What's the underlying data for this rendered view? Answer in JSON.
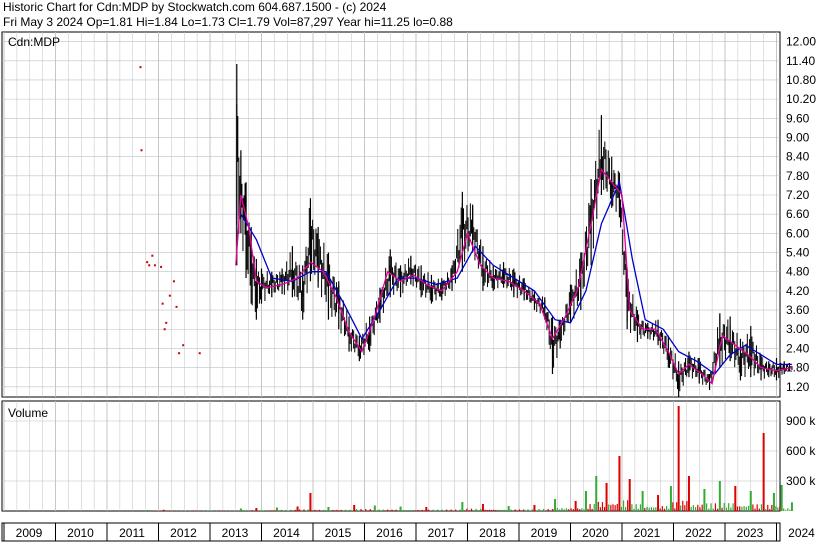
{
  "header": {
    "line1": "Historic Chart for Cdn:MDP by Stockwatch.com 604.687.1500 - (c) 2024",
    "line2": "Fri May  3 2024   Op=1.81  Hi=1.84  Lo=1.73  Cl=1.79  Vol=87,297  Year hi=11.25  lo=0.88"
  },
  "colors": {
    "price_bars": "#000000",
    "ma_short": "#e0009a",
    "ma_long": "#0000cc",
    "early_points": "#cc0000",
    "volume_up": "#33aa33",
    "volume_down": "#dd0000",
    "grid": "#c0c0c0",
    "panel_border": "#000000"
  },
  "chart_data": [
    {
      "type": "line",
      "title": "Cdn:MDP",
      "xlabel": "",
      "ylabel": "",
      "x_tick_labels": [
        "2009",
        "2010",
        "2011",
        "2012",
        "2013",
        "2014",
        "2015",
        "2016",
        "2017",
        "2018",
        "2019",
        "2020",
        "2021",
        "2022",
        "2023",
        "2024"
      ],
      "y_tick_labels": [
        "12.00",
        "11.40",
        "10.80",
        "10.20",
        "9.60",
        "9.00",
        "8.40",
        "7.80",
        "7.20",
        "6.60",
        "6.00",
        "5.40",
        "4.80",
        "4.20",
        "3.60",
        "3.00",
        "2.40",
        "1.80",
        "1.20"
      ],
      "ylim": [
        0.88,
        12.3
      ],
      "grid": true,
      "series": [
        {
          "kind": "points",
          "values": [
            {
              "x": 2011.65,
              "y": 11.2
            },
            {
              "x": 2011.67,
              "y": 8.6
            },
            {
              "x": 2011.78,
              "y": 5.1
            },
            {
              "x": 2011.82,
              "y": 5.0
            },
            {
              "x": 2011.88,
              "y": 5.3
            },
            {
              "x": 2011.93,
              "y": 5.0
            },
            {
              "x": 2012.05,
              "y": 4.95
            },
            {
              "x": 2012.08,
              "y": 3.8
            },
            {
              "x": 2012.12,
              "y": 3.0
            },
            {
              "x": 2012.15,
              "y": 3.2
            },
            {
              "x": 2012.22,
              "y": 4.05
            },
            {
              "x": 2012.3,
              "y": 4.5
            },
            {
              "x": 2012.35,
              "y": 3.7
            },
            {
              "x": 2012.4,
              "y": 2.25
            },
            {
              "x": 2012.48,
              "y": 2.5
            },
            {
              "x": 2012.8,
              "y": 2.25
            }
          ]
        },
        {
          "kind": "price_bars",
          "values": [
            {
              "x": 2013.52,
              "lo": 5.0,
              "hi": 11.3
            },
            {
              "x": 2013.6,
              "lo": 6.0,
              "hi": 8.6
            },
            {
              "x": 2013.7,
              "lo": 4.6,
              "hi": 7.6
            },
            {
              "x": 2013.8,
              "lo": 3.8,
              "hi": 6.2
            },
            {
              "x": 2013.9,
              "lo": 3.3,
              "hi": 5.2
            },
            {
              "x": 2014.0,
              "lo": 3.8,
              "hi": 4.9
            },
            {
              "x": 2014.2,
              "lo": 4.0,
              "hi": 4.8
            },
            {
              "x": 2014.4,
              "lo": 4.1,
              "hi": 4.9
            },
            {
              "x": 2014.6,
              "lo": 4.0,
              "hi": 5.6
            },
            {
              "x": 2014.8,
              "lo": 3.3,
              "hi": 5.0
            },
            {
              "x": 2014.95,
              "lo": 4.5,
              "hi": 7.1
            },
            {
              "x": 2015.1,
              "lo": 4.3,
              "hi": 6.2
            },
            {
              "x": 2015.3,
              "lo": 3.3,
              "hi": 5.4
            },
            {
              "x": 2015.5,
              "lo": 3.0,
              "hi": 4.5
            },
            {
              "x": 2015.7,
              "lo": 2.3,
              "hi": 3.4
            },
            {
              "x": 2015.9,
              "lo": 2.0,
              "hi": 2.8
            },
            {
              "x": 2016.1,
              "lo": 2.3,
              "hi": 3.4
            },
            {
              "x": 2016.3,
              "lo": 3.2,
              "hi": 4.3
            },
            {
              "x": 2016.5,
              "lo": 4.0,
              "hi": 5.5
            },
            {
              "x": 2016.7,
              "lo": 4.0,
              "hi": 5.0
            },
            {
              "x": 2016.9,
              "lo": 4.4,
              "hi": 5.3
            },
            {
              "x": 2017.1,
              "lo": 4.0,
              "hi": 5.0
            },
            {
              "x": 2017.3,
              "lo": 3.8,
              "hi": 4.7
            },
            {
              "x": 2017.5,
              "lo": 3.9,
              "hi": 4.6
            },
            {
              "x": 2017.7,
              "lo": 4.2,
              "hi": 5.0
            },
            {
              "x": 2017.9,
              "lo": 4.8,
              "hi": 7.3
            },
            {
              "x": 2018.1,
              "lo": 5.4,
              "hi": 6.9
            },
            {
              "x": 2018.3,
              "lo": 4.2,
              "hi": 5.6
            },
            {
              "x": 2018.5,
              "lo": 4.2,
              "hi": 5.0
            },
            {
              "x": 2018.7,
              "lo": 4.3,
              "hi": 5.1
            },
            {
              "x": 2018.9,
              "lo": 4.0,
              "hi": 4.9
            },
            {
              "x": 2019.1,
              "lo": 3.9,
              "hi": 4.6
            },
            {
              "x": 2019.3,
              "lo": 3.6,
              "hi": 4.2
            },
            {
              "x": 2019.5,
              "lo": 3.3,
              "hi": 4.0
            },
            {
              "x": 2019.65,
              "lo": 1.6,
              "hi": 3.4
            },
            {
              "x": 2019.8,
              "lo": 2.4,
              "hi": 3.3
            },
            {
              "x": 2020.0,
              "lo": 3.2,
              "hi": 4.4
            },
            {
              "x": 2020.2,
              "lo": 3.6,
              "hi": 5.4
            },
            {
              "x": 2020.4,
              "lo": 5.0,
              "hi": 7.7
            },
            {
              "x": 2020.6,
              "lo": 7.2,
              "hi": 9.7
            },
            {
              "x": 2020.8,
              "lo": 6.8,
              "hi": 8.4
            },
            {
              "x": 2020.95,
              "lo": 6.5,
              "hi": 7.9
            },
            {
              "x": 2021.1,
              "lo": 3.0,
              "hi": 4.9
            },
            {
              "x": 2021.3,
              "lo": 2.6,
              "hi": 3.6
            },
            {
              "x": 2021.5,
              "lo": 2.7,
              "hi": 3.2
            },
            {
              "x": 2021.7,
              "lo": 2.5,
              "hi": 3.3
            },
            {
              "x": 2021.9,
              "lo": 1.8,
              "hi": 2.8
            },
            {
              "x": 2022.1,
              "lo": 0.88,
              "hi": 2.0
            },
            {
              "x": 2022.3,
              "lo": 1.5,
              "hi": 2.3
            },
            {
              "x": 2022.5,
              "lo": 1.3,
              "hi": 2.1
            },
            {
              "x": 2022.7,
              "lo": 1.1,
              "hi": 1.6
            },
            {
              "x": 2022.9,
              "lo": 1.8,
              "hi": 3.5
            },
            {
              "x": 2023.1,
              "lo": 2.0,
              "hi": 3.4
            },
            {
              "x": 2023.3,
              "lo": 1.4,
              "hi": 2.7
            },
            {
              "x": 2023.5,
              "lo": 1.5,
              "hi": 3.1
            },
            {
              "x": 2023.7,
              "lo": 1.4,
              "hi": 2.2
            },
            {
              "x": 2023.85,
              "lo": 1.5,
              "hi": 2.0
            },
            {
              "x": 2024.0,
              "lo": 1.4,
              "hi": 2.1
            },
            {
              "x": 2024.15,
              "lo": 1.6,
              "hi": 2.0
            },
            {
              "x": 2024.3,
              "lo": 1.73,
              "hi": 1.84
            }
          ]
        },
        {
          "kind": "line",
          "values": [
            {
              "x": 2013.5,
              "y": 5.0
            },
            {
              "x": 2013.6,
              "y": 7.2
            },
            {
              "x": 2013.75,
              "y": 6.2
            },
            {
              "x": 2013.9,
              "y": 4.5
            },
            {
              "x": 2014.1,
              "y": 4.3
            },
            {
              "x": 2014.4,
              "y": 4.4
            },
            {
              "x": 2014.7,
              "y": 4.6
            },
            {
              "x": 2014.95,
              "y": 5.1
            },
            {
              "x": 2015.2,
              "y": 4.8
            },
            {
              "x": 2015.45,
              "y": 4.0
            },
            {
              "x": 2015.7,
              "y": 2.9
            },
            {
              "x": 2015.95,
              "y": 2.3
            },
            {
              "x": 2016.2,
              "y": 3.4
            },
            {
              "x": 2016.45,
              "y": 4.8
            },
            {
              "x": 2016.7,
              "y": 4.5
            },
            {
              "x": 2016.95,
              "y": 4.7
            },
            {
              "x": 2017.2,
              "y": 4.4
            },
            {
              "x": 2017.5,
              "y": 4.2
            },
            {
              "x": 2017.8,
              "y": 4.8
            },
            {
              "x": 2018.0,
              "y": 6.0
            },
            {
              "x": 2018.25,
              "y": 5.0
            },
            {
              "x": 2018.5,
              "y": 4.6
            },
            {
              "x": 2018.8,
              "y": 4.5
            },
            {
              "x": 2019.1,
              "y": 4.2
            },
            {
              "x": 2019.4,
              "y": 3.8
            },
            {
              "x": 2019.65,
              "y": 2.7
            },
            {
              "x": 2019.9,
              "y": 3.4
            },
            {
              "x": 2020.15,
              "y": 4.3
            },
            {
              "x": 2020.4,
              "y": 6.3
            },
            {
              "x": 2020.6,
              "y": 8.0
            },
            {
              "x": 2020.85,
              "y": 7.5
            },
            {
              "x": 2021.0,
              "y": 7.2
            },
            {
              "x": 2021.15,
              "y": 3.6
            },
            {
              "x": 2021.4,
              "y": 3.0
            },
            {
              "x": 2021.65,
              "y": 3.0
            },
            {
              "x": 2021.9,
              "y": 2.3
            },
            {
              "x": 2022.1,
              "y": 1.6
            },
            {
              "x": 2022.3,
              "y": 1.9
            },
            {
              "x": 2022.55,
              "y": 1.6
            },
            {
              "x": 2022.75,
              "y": 1.3
            },
            {
              "x": 2022.95,
              "y": 2.8
            },
            {
              "x": 2023.2,
              "y": 2.5
            },
            {
              "x": 2023.45,
              "y": 2.2
            },
            {
              "x": 2023.7,
              "y": 1.8
            },
            {
              "x": 2024.0,
              "y": 1.7
            },
            {
              "x": 2024.3,
              "y": 1.8
            }
          ]
        },
        {
          "kind": "line",
          "values": [
            {
              "x": 2013.6,
              "y": 6.6
            },
            {
              "x": 2013.9,
              "y": 5.8
            },
            {
              "x": 2014.2,
              "y": 4.6
            },
            {
              "x": 2014.6,
              "y": 4.5
            },
            {
              "x": 2014.95,
              "y": 4.8
            },
            {
              "x": 2015.25,
              "y": 4.8
            },
            {
              "x": 2015.6,
              "y": 3.8
            },
            {
              "x": 2015.95,
              "y": 2.7
            },
            {
              "x": 2016.3,
              "y": 3.6
            },
            {
              "x": 2016.65,
              "y": 4.6
            },
            {
              "x": 2017.0,
              "y": 4.6
            },
            {
              "x": 2017.4,
              "y": 4.4
            },
            {
              "x": 2017.8,
              "y": 4.6
            },
            {
              "x": 2018.15,
              "y": 5.6
            },
            {
              "x": 2018.5,
              "y": 5.0
            },
            {
              "x": 2018.9,
              "y": 4.6
            },
            {
              "x": 2019.3,
              "y": 4.2
            },
            {
              "x": 2019.7,
              "y": 3.3
            },
            {
              "x": 2020.0,
              "y": 3.2
            },
            {
              "x": 2020.3,
              "y": 4.2
            },
            {
              "x": 2020.6,
              "y": 6.3
            },
            {
              "x": 2020.95,
              "y": 7.6
            },
            {
              "x": 2021.2,
              "y": 5.2
            },
            {
              "x": 2021.45,
              "y": 3.3
            },
            {
              "x": 2021.8,
              "y": 3.0
            },
            {
              "x": 2022.1,
              "y": 2.3
            },
            {
              "x": 2022.45,
              "y": 2.0
            },
            {
              "x": 2022.8,
              "y": 1.6
            },
            {
              "x": 2023.1,
              "y": 2.2
            },
            {
              "x": 2023.4,
              "y": 2.5
            },
            {
              "x": 2023.7,
              "y": 2.2
            },
            {
              "x": 2024.0,
              "y": 1.9
            },
            {
              "x": 2024.3,
              "y": 1.9
            }
          ]
        }
      ]
    },
    {
      "type": "bar",
      "title": "Volume",
      "xlabel": "",
      "ylabel": "",
      "y_tick_labels": [
        "900 k",
        "600 k",
        "300 k"
      ],
      "ylim": [
        0,
        1100000
      ],
      "grid": true,
      "series": [
        {
          "name": "",
          "values": [
            {
              "x": 2011.8,
              "v": 10000,
              "up": true
            },
            {
              "x": 2012.1,
              "v": 12000,
              "up": false
            },
            {
              "x": 2013.6,
              "v": 25000,
              "up": true
            },
            {
              "x": 2013.9,
              "v": 30000,
              "up": false
            },
            {
              "x": 2014.3,
              "v": 35000,
              "up": true
            },
            {
              "x": 2014.7,
              "v": 45000,
              "up": false
            },
            {
              "x": 2014.95,
              "v": 180000,
              "up": false
            },
            {
              "x": 2015.3,
              "v": 40000,
              "up": true
            },
            {
              "x": 2015.8,
              "v": 60000,
              "up": false
            },
            {
              "x": 2016.2,
              "v": 55000,
              "up": true
            },
            {
              "x": 2016.7,
              "v": 45000,
              "up": true
            },
            {
              "x": 2017.2,
              "v": 40000,
              "up": false
            },
            {
              "x": 2017.9,
              "v": 90000,
              "up": true
            },
            {
              "x": 2018.3,
              "v": 70000,
              "up": false
            },
            {
              "x": 2018.8,
              "v": 50000,
              "up": true
            },
            {
              "x": 2019.3,
              "v": 60000,
              "up": false
            },
            {
              "x": 2019.7,
              "v": 120000,
              "up": true
            },
            {
              "x": 2020.1,
              "v": 100000,
              "up": false
            },
            {
              "x": 2020.3,
              "v": 200000,
              "up": true
            },
            {
              "x": 2020.5,
              "v": 350000,
              "up": true
            },
            {
              "x": 2020.7,
              "v": 280000,
              "up": false
            },
            {
              "x": 2020.95,
              "v": 550000,
              "up": false
            },
            {
              "x": 2021.15,
              "v": 320000,
              "up": false
            },
            {
              "x": 2021.4,
              "v": 200000,
              "up": true
            },
            {
              "x": 2021.7,
              "v": 160000,
              "up": false
            },
            {
              "x": 2021.95,
              "v": 250000,
              "up": true
            },
            {
              "x": 2022.1,
              "v": 1050000,
              "up": false
            },
            {
              "x": 2022.3,
              "v": 350000,
              "up": false
            },
            {
              "x": 2022.6,
              "v": 220000,
              "up": true
            },
            {
              "x": 2022.9,
              "v": 300000,
              "up": true
            },
            {
              "x": 2023.2,
              "v": 250000,
              "up": false
            },
            {
              "x": 2023.5,
              "v": 200000,
              "up": true
            },
            {
              "x": 2023.75,
              "v": 780000,
              "up": false
            },
            {
              "x": 2023.95,
              "v": 180000,
              "up": true
            },
            {
              "x": 2024.1,
              "v": 260000,
              "up": true
            },
            {
              "x": 2024.3,
              "v": 87297,
              "up": true
            }
          ]
        }
      ]
    }
  ]
}
